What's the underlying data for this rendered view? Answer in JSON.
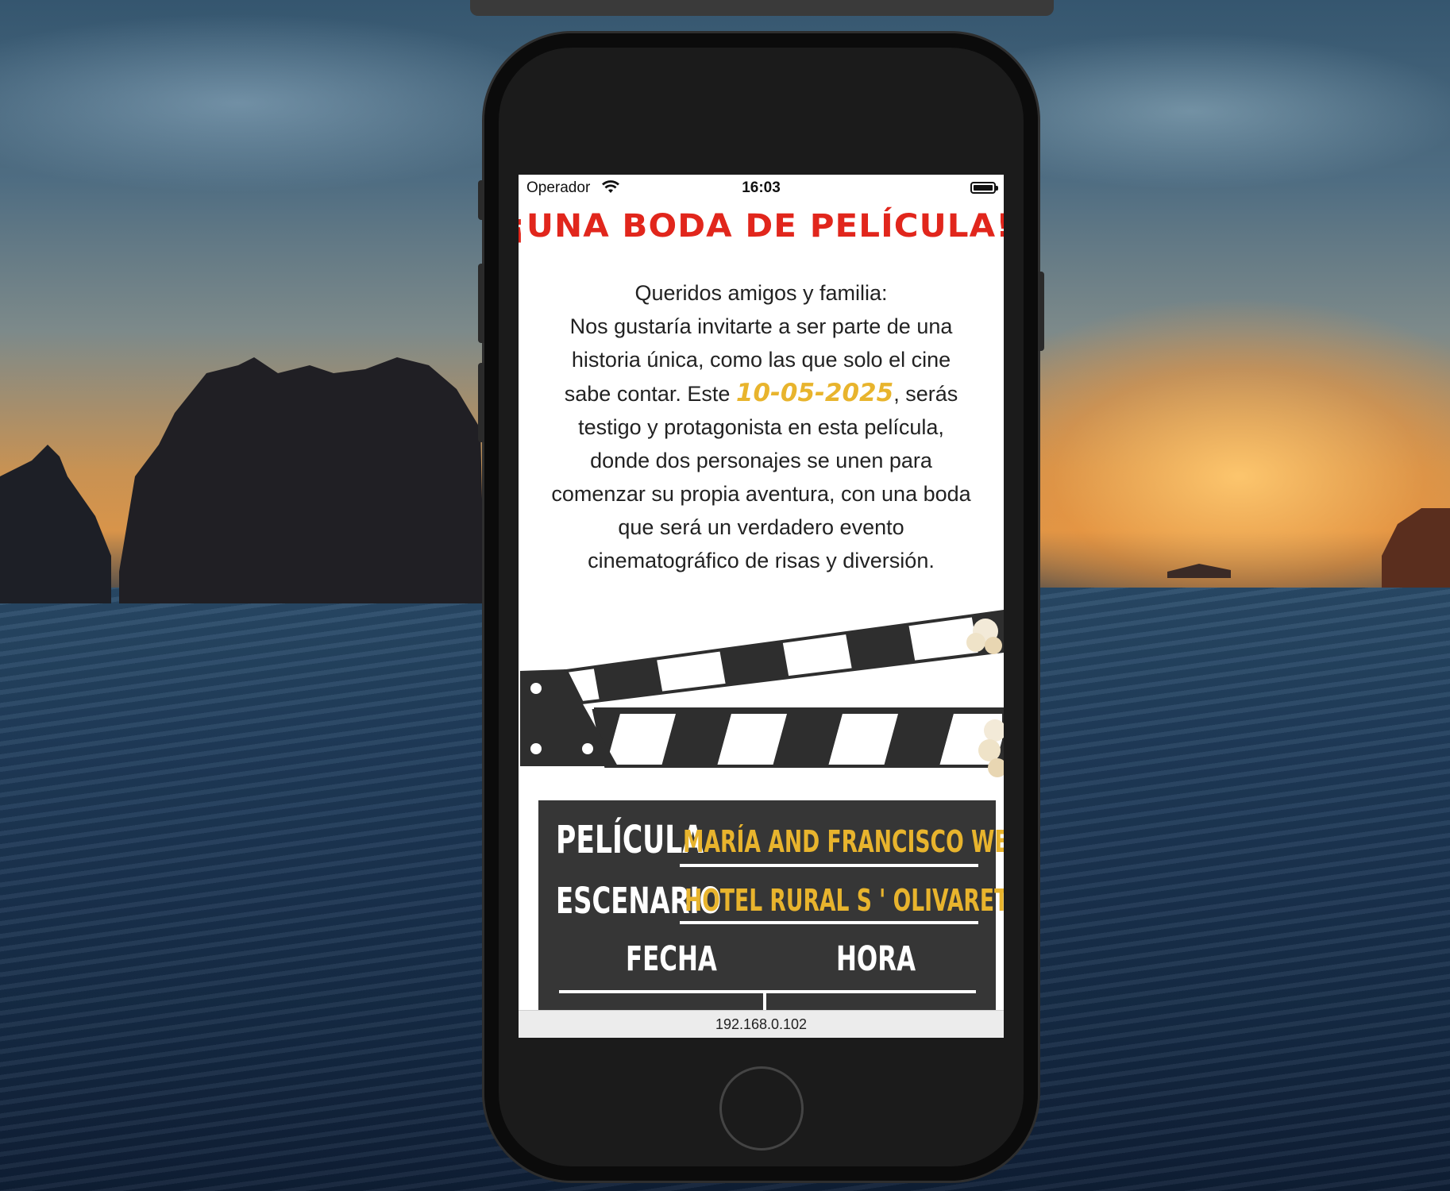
{
  "status_bar": {
    "carrier": "Operador",
    "time": "16:03"
  },
  "invitation": {
    "title": "¡UNA BODA DE PELÍCULA!",
    "greeting": "Queridos amigos y familia:",
    "text_before_date": "Nos gustaría invitarte a ser parte de una historia única, como las que solo el cine sabe contar. Este ",
    "date": "10-05-2025",
    "text_after_date": ", serás testigo y protagonista en esta película, donde dos personajes se unen para comenzar su propia aventura, con una boda que será un verdadero evento cinematográfico de risas y diversión."
  },
  "clapboard": {
    "pelicula_label": "PELÍCULA",
    "pelicula_value": "MARÍA AND FRANCISCO WEDDING",
    "escenario_label": "ESCENARIO",
    "escenario_value": "HOTEL RURAL S ' OLIVARET",
    "fecha_label": "FECHA",
    "hora_label": "HORA"
  },
  "browser": {
    "url": "192.168.0.102"
  },
  "colors": {
    "title_red": "#e1261c",
    "accent_gold": "#e8b42d",
    "clapboard_dark": "#363636"
  },
  "icons": [
    "wifi-icon",
    "battery-icon",
    "popcorn-icon",
    "home-button"
  ]
}
